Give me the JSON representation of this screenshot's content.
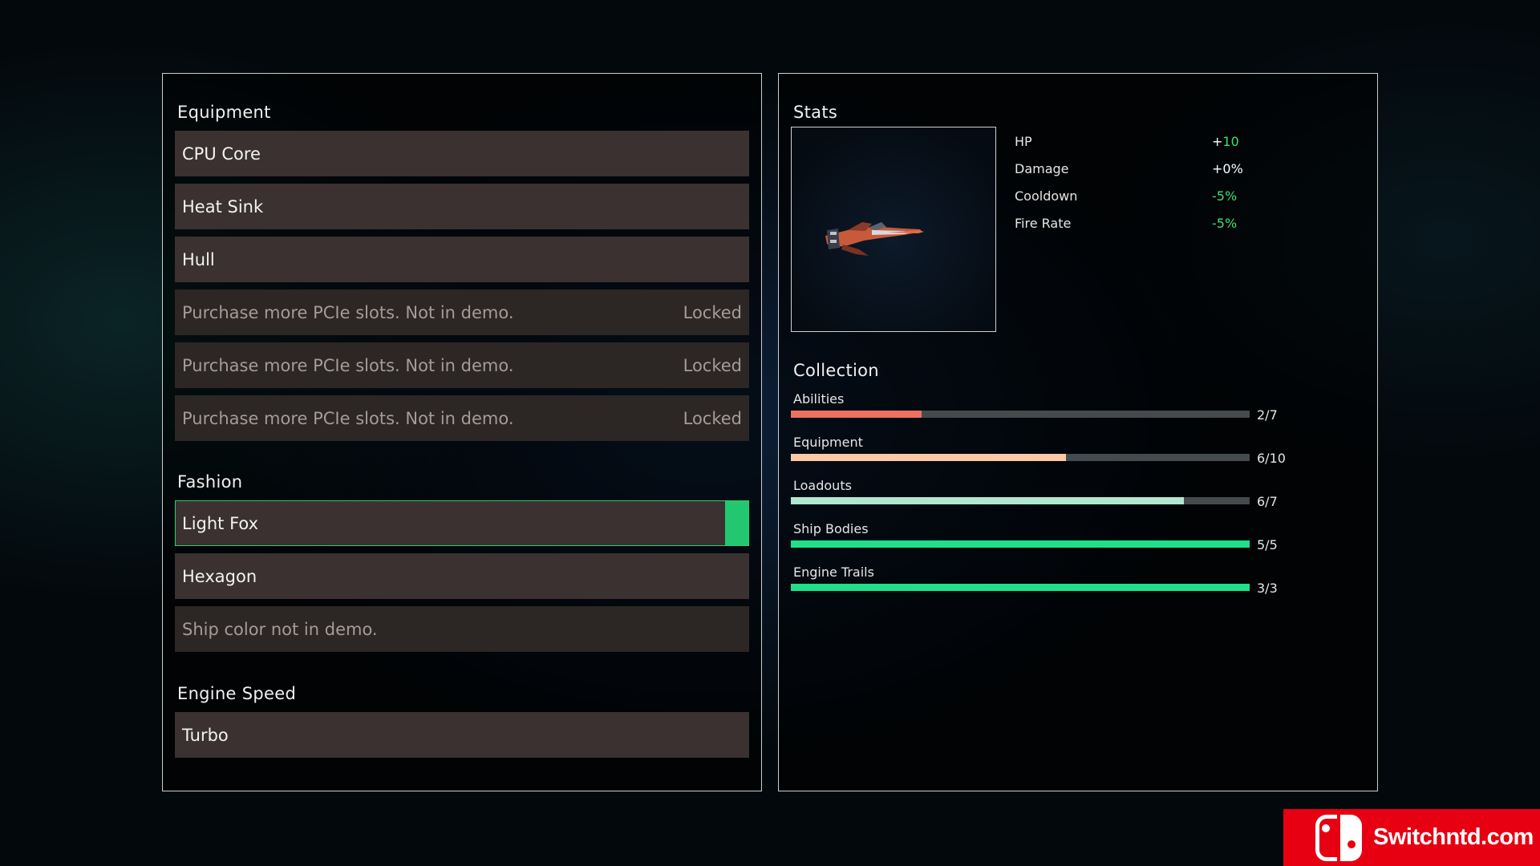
{
  "left_panel": {
    "equipment": {
      "title": "Equipment",
      "slots": [
        {
          "label": "CPU Core"
        },
        {
          "label": "Heat Sink"
        },
        {
          "label": "Hull"
        },
        {
          "label": "Purchase more PCIe slots. Not in demo.",
          "status": "Locked"
        },
        {
          "label": "Purchase more PCIe slots. Not in demo.",
          "status": "Locked"
        },
        {
          "label": "Purchase more PCIe slots. Not in demo.",
          "status": "Locked"
        }
      ]
    },
    "fashion": {
      "title": "Fashion",
      "slots": [
        {
          "label": "Light Fox",
          "selected": true
        },
        {
          "label": "Hexagon"
        },
        {
          "label": "Ship color not in demo."
        }
      ]
    },
    "engine_speed": {
      "title": "Engine Speed",
      "slots": [
        {
          "label": "Turbo"
        }
      ]
    }
  },
  "right_panel": {
    "stats": {
      "title": "Stats",
      "rows": [
        {
          "label": "HP",
          "sign": "+",
          "value": "10"
        },
        {
          "label": "Damage",
          "sign": "+",
          "value": "0%"
        },
        {
          "label": "Cooldown",
          "sign": "-",
          "value": "5%"
        },
        {
          "label": "Fire Rate",
          "sign": "-",
          "value": "5%"
        }
      ]
    },
    "collection": {
      "title": "Collection",
      "items": [
        {
          "label": "Abilities",
          "count": "2/7",
          "fraction": 0.2857,
          "color": "#ee7060"
        },
        {
          "label": "Equipment",
          "count": "6/10",
          "fraction": 0.6,
          "color": "#fcc9a4"
        },
        {
          "label": "Loadouts",
          "count": "6/7",
          "fraction": 0.857,
          "color": "#aee8d0"
        },
        {
          "label": "Ship Bodies",
          "count": "5/5",
          "fraction": 1.0,
          "color": "#1fe08a"
        },
        {
          "label": "Engine Trails",
          "count": "3/3",
          "fraction": 1.0,
          "color": "#1fe08a"
        }
      ]
    }
  },
  "watermark": {
    "text": "Switchntd.com",
    "logo": "nintendo-switch-logo"
  }
}
